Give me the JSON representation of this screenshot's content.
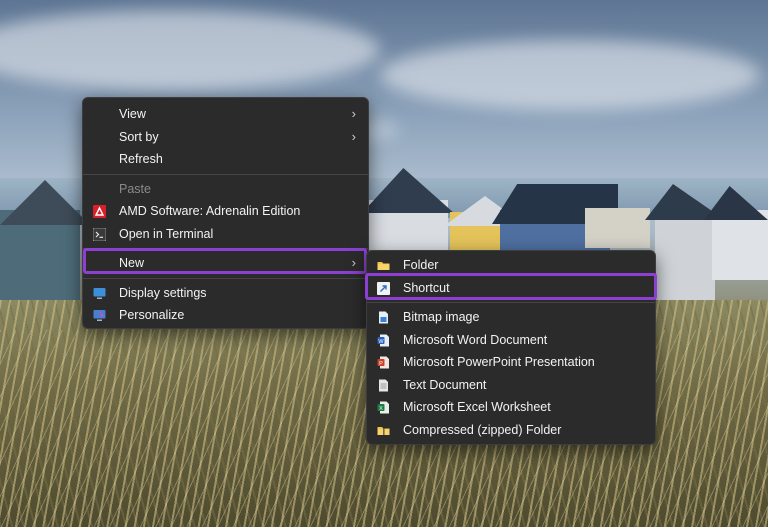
{
  "main_menu": {
    "items": [
      {
        "label": "View",
        "has_submenu": true
      },
      {
        "label": "Sort by",
        "has_submenu": true
      },
      {
        "label": "Refresh"
      },
      {
        "label": "Paste",
        "disabled": true
      },
      {
        "label": "AMD Software: Adrenalin Edition",
        "icon": "amd-icon"
      },
      {
        "label": "Open in Terminal",
        "icon": "terminal-icon"
      },
      {
        "label": "New",
        "has_submenu": true,
        "highlighted": true
      },
      {
        "label": "Display settings",
        "icon": "display-icon"
      },
      {
        "label": "Personalize",
        "icon": "personalize-icon"
      }
    ]
  },
  "new_submenu": {
    "items": [
      {
        "label": "Folder",
        "icon": "folder-icon"
      },
      {
        "label": "Shortcut",
        "icon": "shortcut-icon",
        "highlighted": true
      },
      {
        "label": "Bitmap image",
        "icon": "bitmap-icon"
      },
      {
        "label": "Microsoft Word Document",
        "icon": "word-icon"
      },
      {
        "label": "Microsoft PowerPoint Presentation",
        "icon": "powerpoint-icon"
      },
      {
        "label": "Text Document",
        "icon": "text-document-icon"
      },
      {
        "label": "Microsoft Excel Worksheet",
        "icon": "excel-icon"
      },
      {
        "label": "Compressed (zipped) Folder",
        "icon": "zip-folder-icon"
      }
    ]
  },
  "colors": {
    "menu_bg": "#2b2b2b",
    "highlight": "#8c3fd1"
  }
}
